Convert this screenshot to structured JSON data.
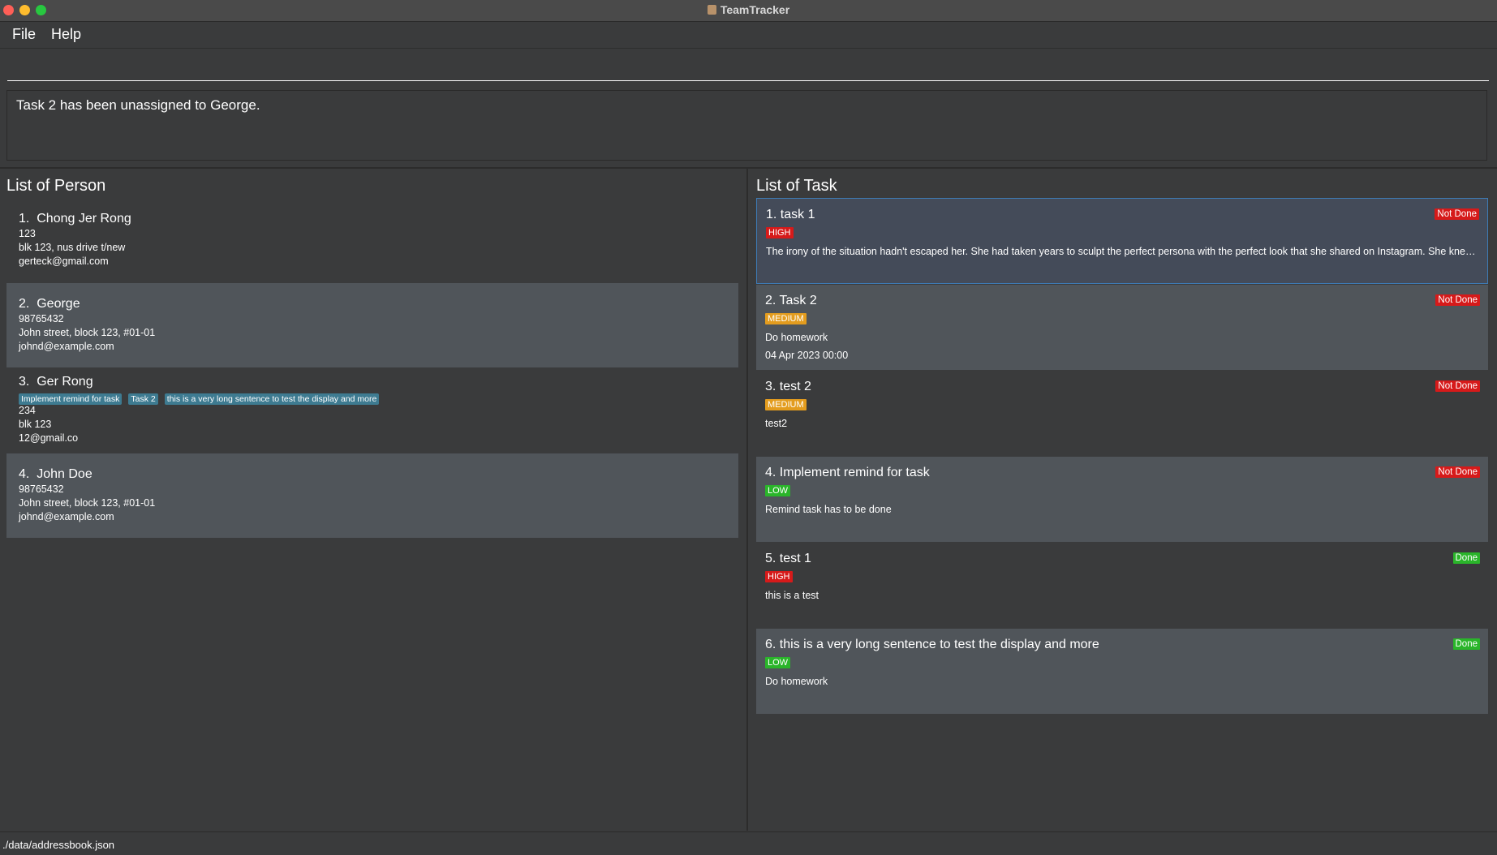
{
  "window": {
    "title": "TeamTracker"
  },
  "menu": {
    "file": "File",
    "help": "Help"
  },
  "command": {
    "value": "",
    "placeholder": ""
  },
  "result": {
    "text": "Task 2 has been unassigned to George."
  },
  "persons": {
    "title": "List of Person",
    "items": [
      {
        "index": "1.",
        "name": "Chong Jer Rong",
        "tags": [],
        "phone": "123",
        "address": "blk 123, nus drive t/new",
        "email": "gerteck@gmail.com"
      },
      {
        "index": "2.",
        "name": "George",
        "tags": [],
        "phone": "98765432",
        "address": "John street, block 123, #01-01",
        "email": "johnd@example.com"
      },
      {
        "index": "3.",
        "name": "Ger Rong",
        "tags": [
          "Implement remind for task",
          "Task 2",
          "this is a very long sentence to test the display and more"
        ],
        "phone": "234",
        "address": "blk 123",
        "email": "12@gmail.co"
      },
      {
        "index": "4.",
        "name": "John Doe",
        "tags": [],
        "phone": "98765432",
        "address": "John street, block 123, #01-01",
        "email": "johnd@example.com"
      }
    ]
  },
  "tasks": {
    "title": "List of Task",
    "items": [
      {
        "title": "1. task 1",
        "priority": "HIGH",
        "status": "Not Done",
        "description": "The irony of the situation hadn't escaped her. She had taken years to sculpt the perfect persona with the perfect look that she shared on Instagram. She knew her ...",
        "deadline": ""
      },
      {
        "title": "2. Task 2",
        "priority": "MEDIUM",
        "status": "Not Done",
        "description": "Do homework",
        "deadline": "04 Apr 2023 00:00"
      },
      {
        "title": "3. test 2",
        "priority": "MEDIUM",
        "status": "Not Done",
        "description": "test2",
        "deadline": ""
      },
      {
        "title": "4. Implement remind for task",
        "priority": "LOW",
        "status": "Not Done",
        "description": "Remind task has to be done",
        "deadline": ""
      },
      {
        "title": "5. test 1",
        "priority": "HIGH",
        "status": "Done",
        "description": "this is a test",
        "deadline": ""
      },
      {
        "title": "6. this is a very long sentence to test the display and more",
        "priority": "LOW",
        "status": "Done",
        "description": "Do homework",
        "deadline": ""
      }
    ]
  },
  "statusbar": {
    "path": "./data/addressbook.json"
  },
  "colors": {
    "background": "#3a3b3c",
    "card_light": "#50555a",
    "selected": "#444b59",
    "high": "#d61a1a",
    "medium": "#e39c1e",
    "low": "#2ab52a",
    "tag": "#3e7b91"
  }
}
